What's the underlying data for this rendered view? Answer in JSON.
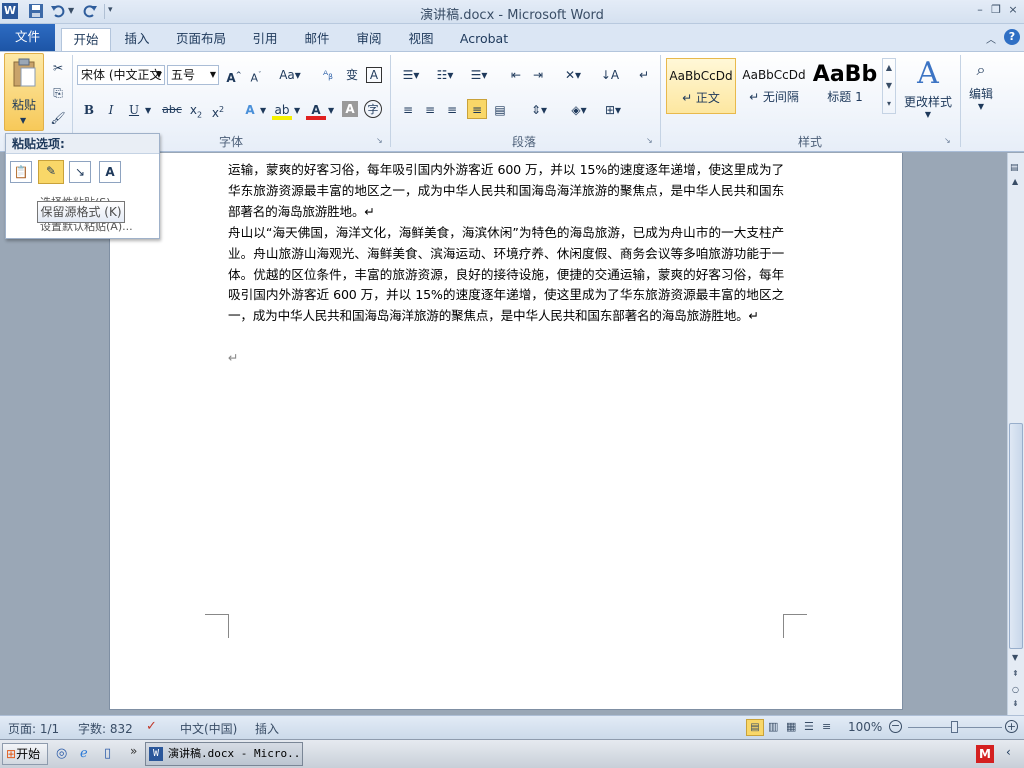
{
  "app": {
    "title": "演讲稿.docx - Microsoft Word"
  },
  "quick_access": {
    "icons": [
      "word-icon",
      "save-icon",
      "undo-icon",
      "redo-icon",
      "customize-icon"
    ],
    "window_buttons": [
      "–",
      "❐",
      "×"
    ]
  },
  "tabs": [
    {
      "label": "文件"
    },
    {
      "label": "开始"
    },
    {
      "label": "插入"
    },
    {
      "label": "页面布局"
    },
    {
      "label": "引用"
    },
    {
      "label": "邮件"
    },
    {
      "label": "审阅"
    },
    {
      "label": "视图"
    },
    {
      "label": "Acrobat"
    }
  ],
  "ribbon": {
    "clipboard": {
      "paste_label": "粘贴"
    },
    "font": {
      "group_label": "字体",
      "font_name": "宋体 (中文正文",
      "font_size": "五号"
    },
    "paragraph": {
      "group_label": "段落"
    },
    "styles": {
      "group_label": "样式",
      "items": [
        {
          "preview": "AaBbCcDd",
          "name": "↵ 正文"
        },
        {
          "preview": "AaBbCcDd",
          "name": "↵ 无间隔"
        },
        {
          "preview": "AaBb",
          "name": "标题 1"
        }
      ],
      "change_styles": "更改样式"
    },
    "editing": {
      "label": "编辑"
    }
  },
  "paste_panel": {
    "title": "粘贴选项:",
    "obscured_text_1": "选择性粘贴(S)...",
    "obscured_text_2": "设置默认粘贴(A)...",
    "tooltip": "保留源格式 (K)"
  },
  "document": {
    "paragraphs": [
      "运输，蒙爽的好客习俗，每年吸引国内外游客近 600 万，并以 15%的速度逐年递增，使这里成为了华东旅游资源最丰富的地区之一，成为中华人民共和国海岛海洋旅游的聚焦点，是中华人民共和国东部著名的海岛旅游胜地。↵",
      "舟山以“海天佛国，海洋文化，海鲜美食，海滨休闲”为特色的海岛旅游，已成为舟山市的一大支柱产业。舟山旅游山海观光、海鲜美食、滨海运动、环境疗养、休闲度假、商务会议等多咱旅游功能于一体。优越的区位条件，丰富的旅游资源，良好的接待设施，便捷的交通运输，蒙爽的好客习俗，每年吸引国内外游客近 600 万，并以 15%的速度逐年递增，使这里成为了华东旅游资源最丰富的地区之一，成为中华人民共和国海岛海洋旅游的聚焦点，是中华人民共和国东部著名的海岛旅游胜地。↵",
      "↵"
    ]
  },
  "status": {
    "page": "页面: 1/1",
    "words": "字数: 832",
    "language": "中文(中国)",
    "mode": "插入",
    "zoom": "100%"
  },
  "taskbar": {
    "start": "开始",
    "window": "演讲稿.docx - Micro..."
  },
  "colors": {
    "file_tab": "#1d55a6",
    "ribbon_bg": "#e7eef8",
    "doc_bg": "#9aa7b6",
    "highlight": "#f9d768"
  }
}
